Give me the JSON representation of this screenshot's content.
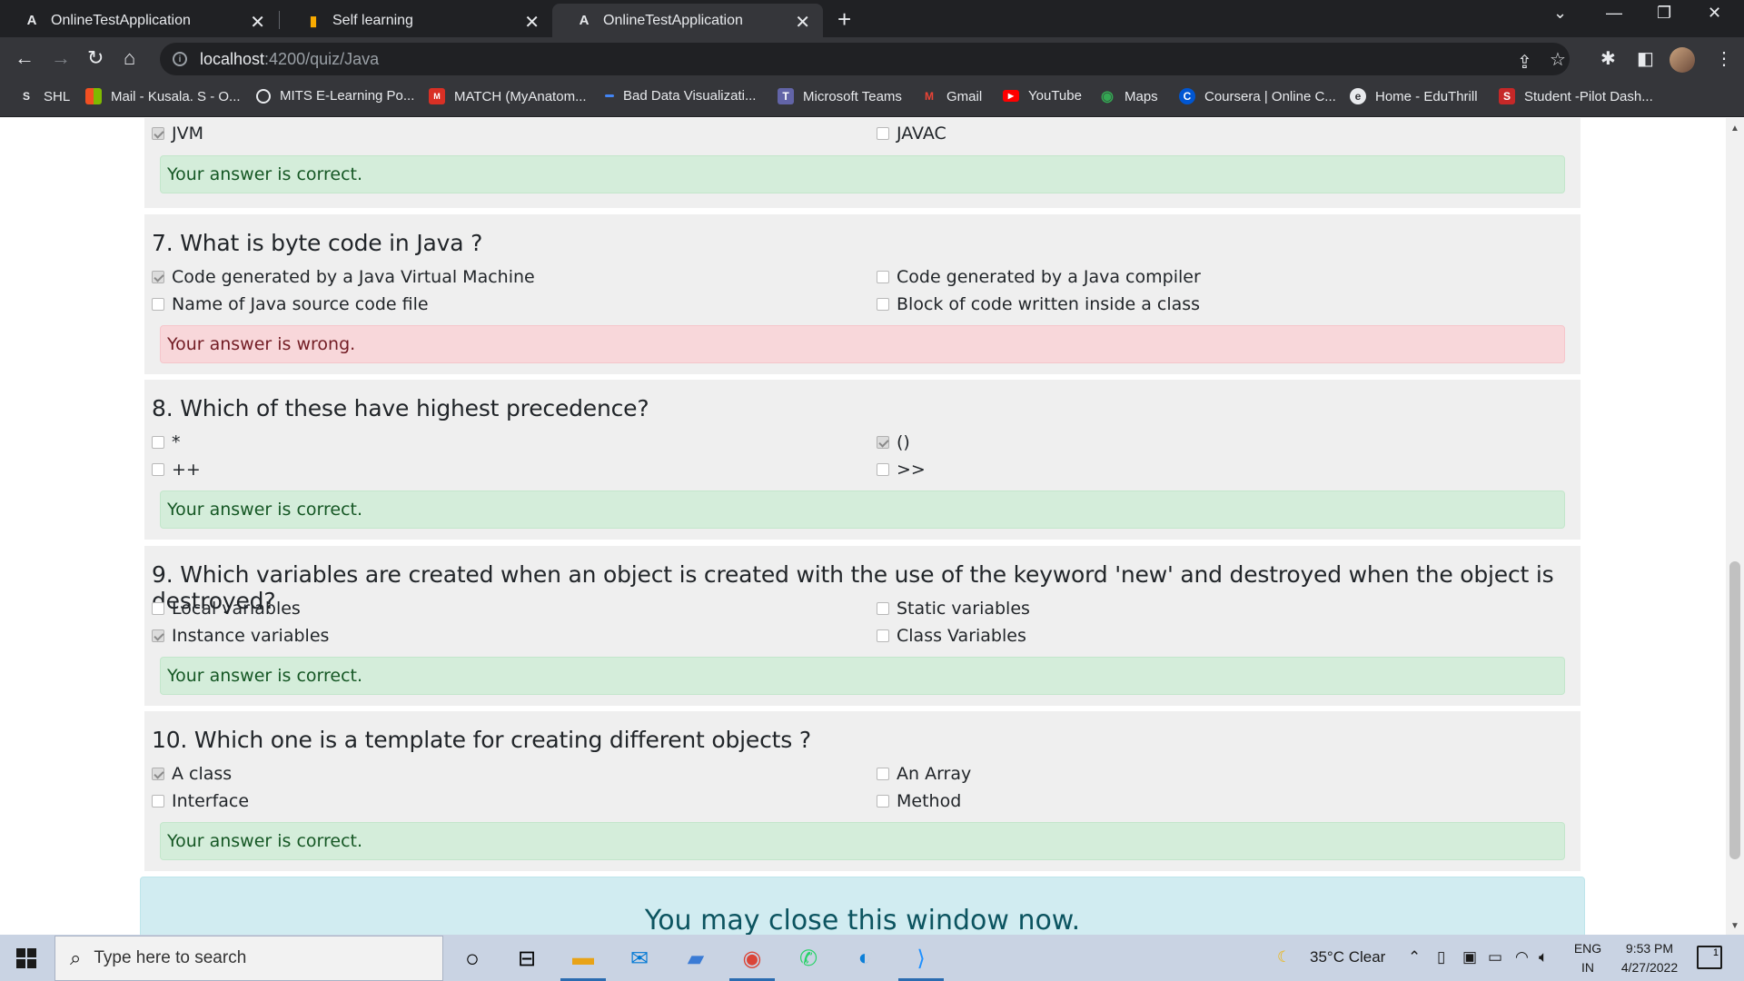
{
  "browser": {
    "tabs": [
      {
        "title": "OnlineTestApplication",
        "favicon": "angular-icon",
        "active": false
      },
      {
        "title": "Self learning",
        "favicon": "chart-icon",
        "active": false
      },
      {
        "title": "OnlineTestApplication",
        "favicon": "angular-icon",
        "active": true
      }
    ],
    "url_host": "localhost",
    "url_path": ":4200/quiz/Java",
    "bookmarks": [
      {
        "label": "SHL",
        "icon": "shl-icon",
        "color": "#e8eaed"
      },
      {
        "label": "Mail - Kusala. S - O...",
        "icon": "microsoft-icon",
        "color": "#f25022"
      },
      {
        "label": "MITS E-Learning Po...",
        "icon": "globe-icon",
        "color": "#e8eaed"
      },
      {
        "label": "MATCH (MyAnatom...",
        "icon": "match-icon",
        "color": "#d93025"
      },
      {
        "label": "Bad Data Visualizati...",
        "icon": "doc-icon",
        "color": "#4285f4"
      },
      {
        "label": "Microsoft Teams",
        "icon": "teams-icon",
        "color": "#6264a7"
      },
      {
        "label": "Gmail",
        "icon": "gmail-icon",
        "color": "#ea4335"
      },
      {
        "label": "YouTube",
        "icon": "youtube-icon",
        "color": "#ff0000"
      },
      {
        "label": "Maps",
        "icon": "maps-icon",
        "color": "#34a853"
      },
      {
        "label": "Coursera | Online C...",
        "icon": "coursera-icon",
        "color": "#0056d2"
      },
      {
        "label": "Home - EduThrill",
        "icon": "eduthrill-icon",
        "color": "#e8eaed"
      },
      {
        "label": "Student -Pilot Dash...",
        "icon": "student-icon",
        "color": "#c62828"
      }
    ]
  },
  "quiz": {
    "partial": {
      "options": [
        {
          "label": "JVM",
          "checked": true
        },
        {
          "label": "JAVAC",
          "checked": false
        }
      ],
      "result": "Your answer is correct.",
      "correct": true
    },
    "questions": [
      {
        "title": "7. What is byte code in Java ?",
        "options": [
          {
            "label": "Code generated by a Java Virtual Machine",
            "checked": true
          },
          {
            "label": "Code generated by a Java compiler",
            "checked": false
          },
          {
            "label": "Name of Java source code file",
            "checked": false
          },
          {
            "label": "Block of code written inside a class",
            "checked": false
          }
        ],
        "result": "Your answer is wrong.",
        "correct": false
      },
      {
        "title": "8. Which of these have highest precedence?",
        "options": [
          {
            "label": "*",
            "checked": false
          },
          {
            "label": "()",
            "checked": true
          },
          {
            "label": "++",
            "checked": false
          },
          {
            "label": ">>",
            "checked": false
          }
        ],
        "result": "Your answer is correct.",
        "correct": true
      },
      {
        "title": "9. Which variables are created when an object is created with the use of the keyword 'new' and destroyed when the object is destroyed?",
        "options": [
          {
            "label": "Local variables",
            "checked": false
          },
          {
            "label": "Static variables",
            "checked": false
          },
          {
            "label": "Instance variables",
            "checked": true
          },
          {
            "label": "Class Variables",
            "checked": false
          }
        ],
        "result": "Your answer is correct.",
        "correct": true
      },
      {
        "title": "10. Which one is a template for creating different objects ?",
        "options": [
          {
            "label": "A class",
            "checked": true
          },
          {
            "label": "An Array",
            "checked": false
          },
          {
            "label": "Interface",
            "checked": false
          },
          {
            "label": "Method",
            "checked": false
          }
        ],
        "result": "Your answer is correct.",
        "correct": true
      }
    ],
    "close_message": "You may close this window now."
  },
  "taskbar": {
    "search_placeholder": "Type here to search",
    "weather": "35°C  Clear",
    "language_line1": "ENG",
    "language_line2": "IN",
    "time": "9:53 PM",
    "date": "4/27/2022",
    "notification_count": "1",
    "apps": [
      "cortana-icon",
      "task-view-icon",
      "file-explorer-icon",
      "mail-icon",
      "computer-icon",
      "chrome-icon",
      "whatsapp-icon",
      "edge-icon",
      "vscode-icon"
    ]
  }
}
